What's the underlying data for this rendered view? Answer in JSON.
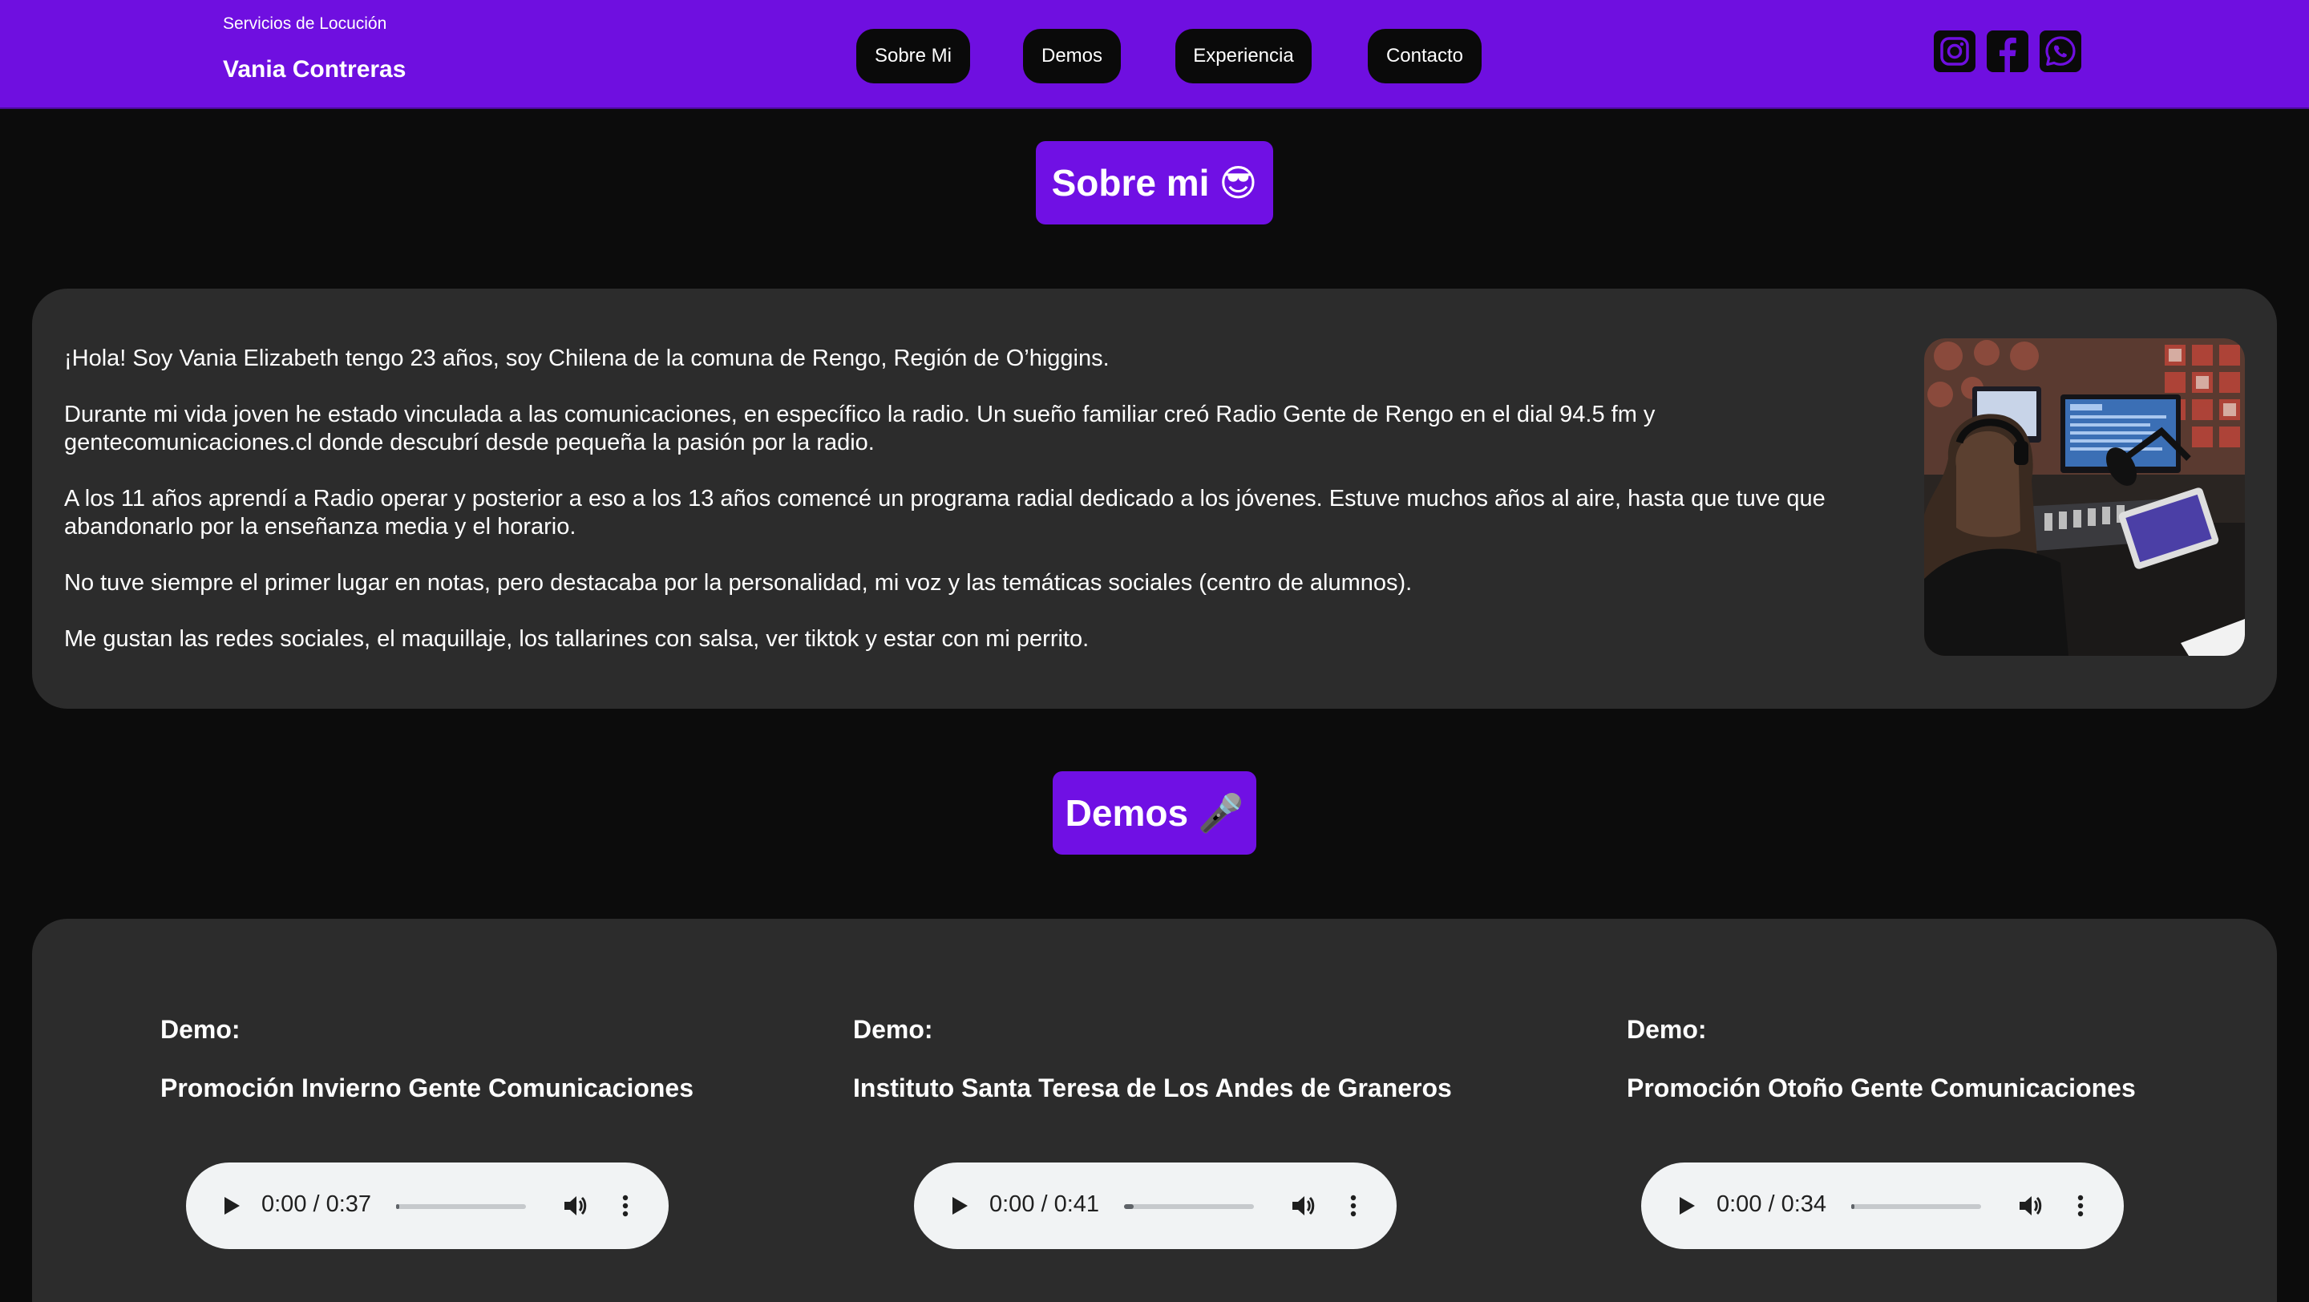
{
  "header": {
    "subtitle": "Servicios de Locución",
    "name": "Vania Contreras",
    "nav": [
      {
        "label": "Sobre Mi"
      },
      {
        "label": "Demos"
      },
      {
        "label": "Experiencia"
      },
      {
        "label": "Contacto"
      }
    ],
    "social_icons": [
      "instagram-icon",
      "facebook-icon",
      "whatsapp-icon"
    ]
  },
  "about": {
    "title": "Sobre mi",
    "title_emoji": "😎",
    "paragraphs": [
      "¡Hola! Soy Vania Elizabeth tengo 23 años, soy Chilena de la comuna de Rengo, Región de O’higgins.",
      "Durante mi vida joven he estado vinculada a las comunicaciones, en específico la radio. Un sueño familiar creó Radio Gente de Rengo en el dial 94.5 fm y gentecomunicaciones.cl donde descubrí desde pequeña la pasión por la radio.",
      "A los 11 años aprendí a Radio operar y posterior a eso a los 13 años comencé un programa radial dedicado a los jóvenes. Estuve muchos años al aire, hasta que tuve que abandonarlo por la enseñanza media y el horario.",
      "No tuve siempre el primer lugar en notas, pero destacaba por la personalidad, mi voz y las temáticas sociales (centro de alumnos).",
      "Me gustan las redes sociales, el maquillaje, los tallarines con salsa, ver tiktok y estar con mi perrito."
    ]
  },
  "demos": {
    "title": "Demos",
    "title_emoji": "🎤",
    "items": [
      {
        "label": "Demo:",
        "title": "Promoción Invierno Gente Comunicaciones",
        "time": "0:00 / 0:37"
      },
      {
        "label": "Demo:",
        "title": "Instituto Santa Teresa de Los Andes de Graneros",
        "time": "0:00 / 0:41"
      },
      {
        "label": "Demo:",
        "title": "Promoción Otoño Gente Comunicaciones",
        "time": "0:00 / 0:34"
      }
    ]
  },
  "colors": {
    "accent": "#7010e4",
    "background": "#0c0c0c",
    "card": "#2c2c2c",
    "nav_button": "#0a0a0a",
    "player": "#f1f3f4"
  }
}
